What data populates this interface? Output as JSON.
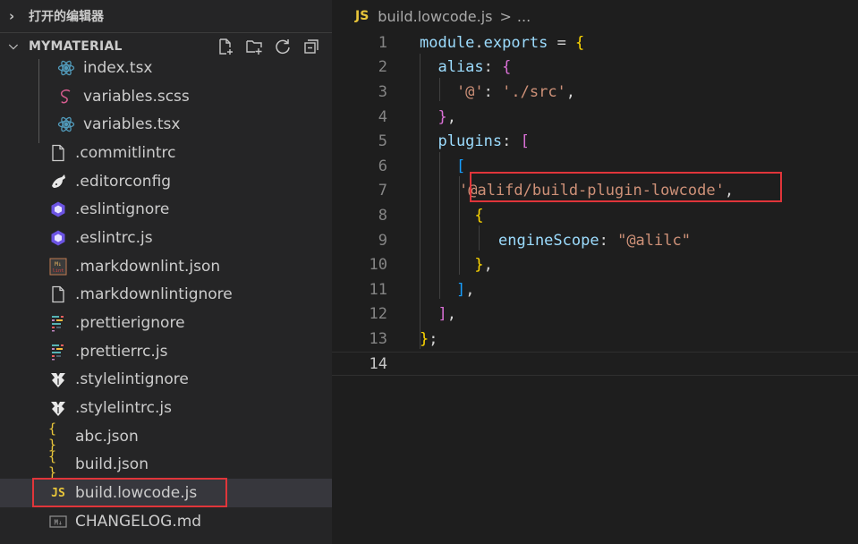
{
  "sidebar": {
    "open_editors_label": "打开的编辑器",
    "section_title": "MYMATERIAL",
    "actions": {
      "new_file": "new-file-icon",
      "new_folder": "new-folder-icon",
      "refresh": "refresh-icon",
      "collapse": "collapse-all-icon"
    },
    "files": [
      {
        "label": "index.tsx",
        "icon": "react-icon",
        "nested": true
      },
      {
        "label": "variables.scss",
        "icon": "sass-icon",
        "nested": true
      },
      {
        "label": "variables.tsx",
        "icon": "react-icon",
        "nested": true
      },
      {
        "label": ".commitlintrc",
        "icon": "file-icon",
        "nested": false
      },
      {
        "label": ".editorconfig",
        "icon": "editorconfig-icon",
        "nested": false
      },
      {
        "label": ".eslintignore",
        "icon": "eslint-icon",
        "nested": false
      },
      {
        "label": ".eslintrc.js",
        "icon": "eslint-icon",
        "nested": false
      },
      {
        "label": ".markdownlint.json",
        "icon": "markdownlint-icon",
        "nested": false
      },
      {
        "label": ".markdownlintignore",
        "icon": "file-icon",
        "nested": false
      },
      {
        "label": ".prettierignore",
        "icon": "prettier-icon",
        "nested": false
      },
      {
        "label": ".prettierrc.js",
        "icon": "prettier-icon",
        "nested": false
      },
      {
        "label": ".stylelintignore",
        "icon": "stylelint-icon",
        "nested": false
      },
      {
        "label": ".stylelintrc.js",
        "icon": "stylelint-icon",
        "nested": false
      },
      {
        "label": "abc.json",
        "icon": "json-icon",
        "nested": false
      },
      {
        "label": "build.json",
        "icon": "json-icon",
        "nested": false
      },
      {
        "label": "build.lowcode.js",
        "icon": "js-icon",
        "nested": false,
        "selected": true
      },
      {
        "label": "CHANGELOG.md",
        "icon": "markdown-icon",
        "nested": false
      }
    ],
    "json_glyph": "{ }",
    "js_glyph": "JS"
  },
  "editor": {
    "breadcrumb": {
      "lang": "JS",
      "file": "build.lowcode.js",
      "separator": ">",
      "more": "..."
    },
    "line_numbers": [
      "1",
      "2",
      "3",
      "4",
      "5",
      "6",
      "7",
      "8",
      "9",
      "10",
      "11",
      "12",
      "13",
      "14"
    ],
    "current_line": 14,
    "code": {
      "l1_a": "module",
      "l1_b": ".",
      "l1_c": "exports",
      "l1_d": " = ",
      "l1_e": "{",
      "l2_a": "  alias",
      "l2_b": ": ",
      "l2_c": "{",
      "l3_a": "    '@'",
      "l3_b": ": ",
      "l3_c": "'./src'",
      "l3_d": ",",
      "l4_a": "  }",
      "l4_b": ",",
      "l5_a": "  plugins",
      "l5_b": ": ",
      "l5_c": "[",
      "l6_a": "    [",
      "l7_a": "'@alifd/build-plugin-lowcode'",
      "l7_b": ",",
      "l8_a": "      {",
      "l9_a": "engineScope",
      "l9_b": ": ",
      "l9_c": "\"@alilc\"",
      "l10_a": "      }",
      "l10_b": ",",
      "l11_a": "    ]",
      "l11_b": ",",
      "l12_a": "  ]",
      "l12_b": ",",
      "l13_a": "}",
      "l13_b": ";"
    }
  },
  "colors": {
    "highlight_box": "#e0353a",
    "js_icon": "#e8c53a",
    "json_icon": "#e8c53a",
    "react_icon": "#519aba",
    "sass_icon": "#d55c8e",
    "eslint_icon": "#6c54e3"
  }
}
